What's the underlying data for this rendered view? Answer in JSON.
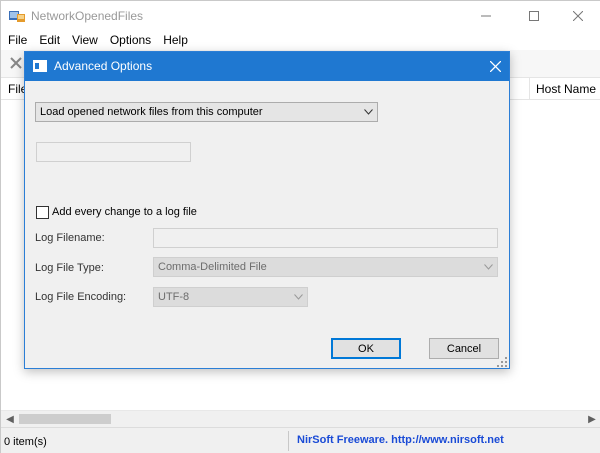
{
  "app": {
    "title": "NetworkOpenedFiles",
    "menu": [
      "File",
      "Edit",
      "View",
      "Options",
      "Help"
    ]
  },
  "list": {
    "columns": [
      "File",
      "Host Name"
    ]
  },
  "status": {
    "items": "0 item(s)",
    "credit": "NirSoft Freeware.  http://www.nirsoft.net"
  },
  "dialog": {
    "title": "Advanced Options",
    "mode_value": "Load opened network files from this computer",
    "computer_name_value": "",
    "log_checkbox_label": "Add every change to a log file",
    "log_checkbox_checked": false,
    "log_filename_label": "Log Filename:",
    "log_filename_value": "",
    "log_filetype_label": "Log File Type:",
    "log_filetype_value": "Comma-Delimited File",
    "log_encoding_label": "Log File Encoding:",
    "log_encoding_value": "UTF-8",
    "ok_label": "OK",
    "cancel_label": "Cancel"
  },
  "colors": {
    "dialog_titlebar": "#1f78d1",
    "link_text": "#1a4bd6",
    "default_button_border": "#0078d7"
  },
  "icons": [
    "app-icon",
    "minimize-icon",
    "maximize-icon",
    "close-icon",
    "delete-icon",
    "dialog-icon",
    "dialog-close-icon",
    "chevron-down-icon",
    "scroll-left-icon",
    "scroll-right-icon",
    "resize-grip-icon"
  ]
}
